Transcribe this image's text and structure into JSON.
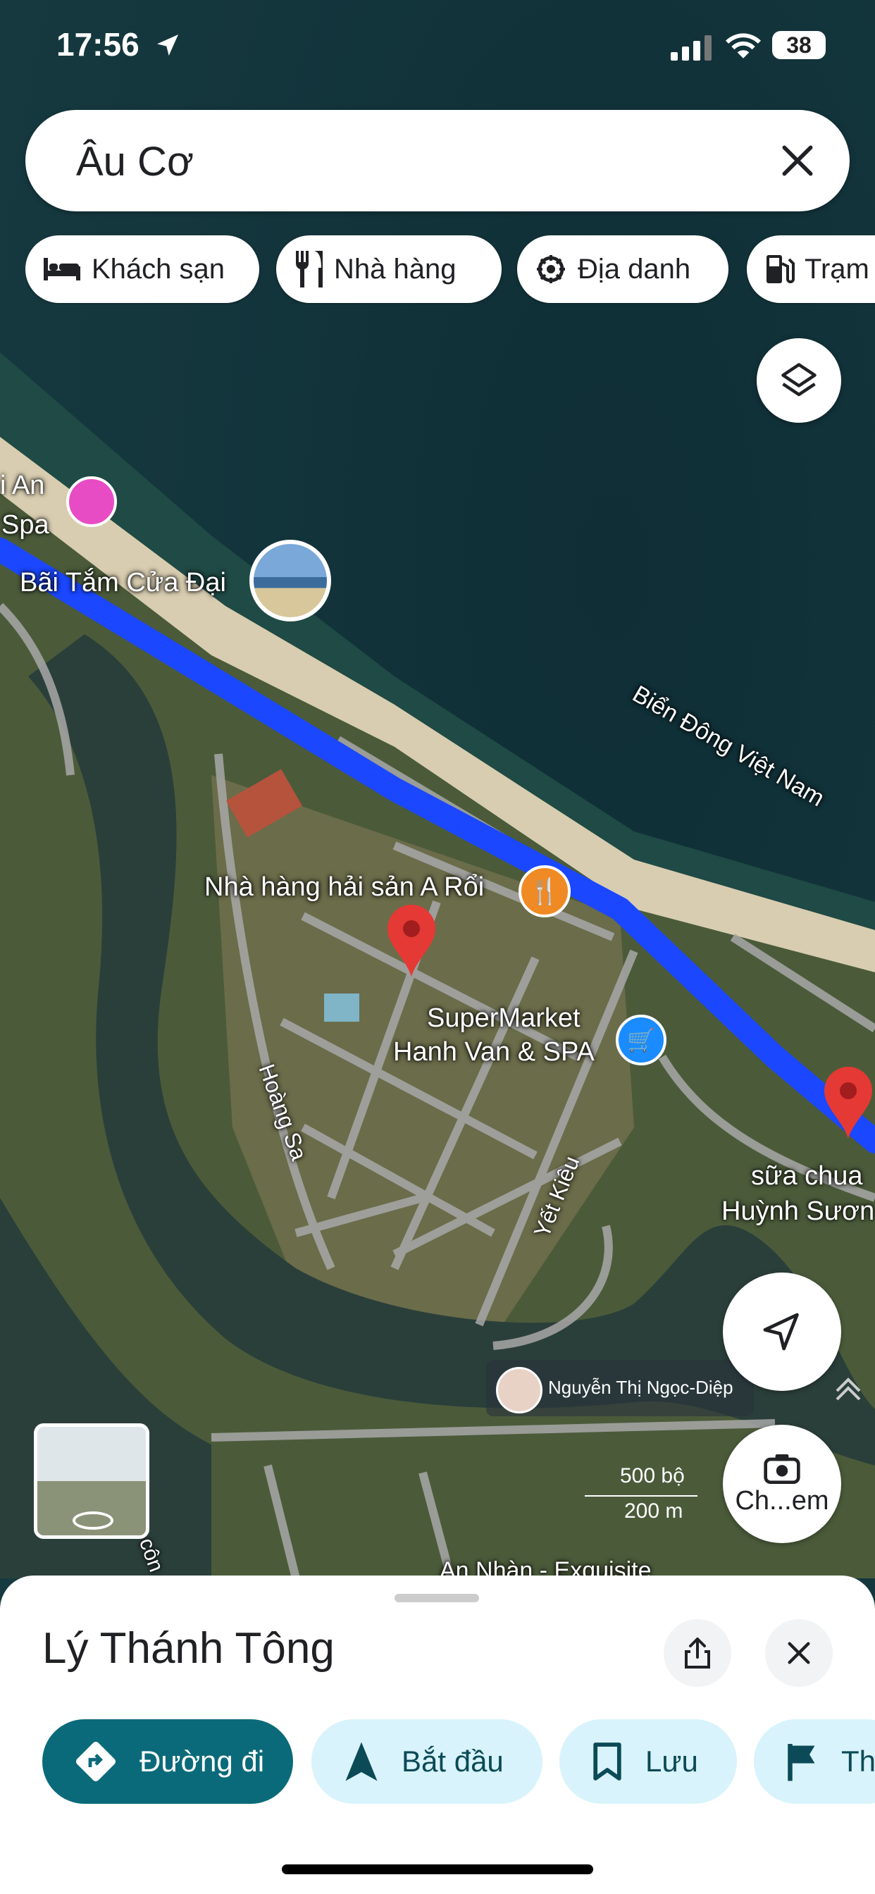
{
  "status_bar": {
    "time": "17:56",
    "battery": "38"
  },
  "search": {
    "query": "Âu Cơ"
  },
  "chips": [
    {
      "label": "Khách sạn",
      "icon": "bed-icon"
    },
    {
      "label": "Nhà hàng",
      "icon": "restaurant-icon"
    },
    {
      "label": "Địa danh",
      "icon": "landmark-icon"
    },
    {
      "label": "Trạm",
      "icon": "gas-station-icon"
    }
  ],
  "map": {
    "labels": {
      "spa_partial_1": "i An",
      "spa_partial_2": "Spa",
      "beach": "Bãi Tắm Cửa Đại",
      "sea": "Biển Đông Việt Nam",
      "restaurant": "Nhà hàng hải sản A Rổi",
      "supermarket_1": "SuperMarket",
      "supermarket_2": "Hanh Van & SPA",
      "road_hoang_sa": "Hoàng Sa",
      "road_yet_kieu": "Yết Kiêu",
      "yogurt_1": "sữa chua",
      "yogurt_2": "Huỳnh Sươn",
      "contributor": "Nguyễn Thị Ngọc-Diệp",
      "bottom_place": "An Nhàn - Exquisite",
      "partial_bottom": "côn"
    },
    "scale": {
      "imperial": "500 bộ",
      "metric": "200 m"
    },
    "route_color": "#1a47ff",
    "lens_label": "Ch...em"
  },
  "sheet": {
    "title": "Lý Thánh Tông",
    "actions": [
      {
        "label": "Đường đi",
        "icon": "directions-icon"
      },
      {
        "label": "Bắt đầu",
        "icon": "navigation-arrow-icon"
      },
      {
        "label": "Lưu",
        "icon": "bookmark-icon"
      },
      {
        "label": "Th",
        "icon": "flag-icon"
      }
    ],
    "accent": "#0b6a7a",
    "action_bg": "#d8f3fb"
  }
}
